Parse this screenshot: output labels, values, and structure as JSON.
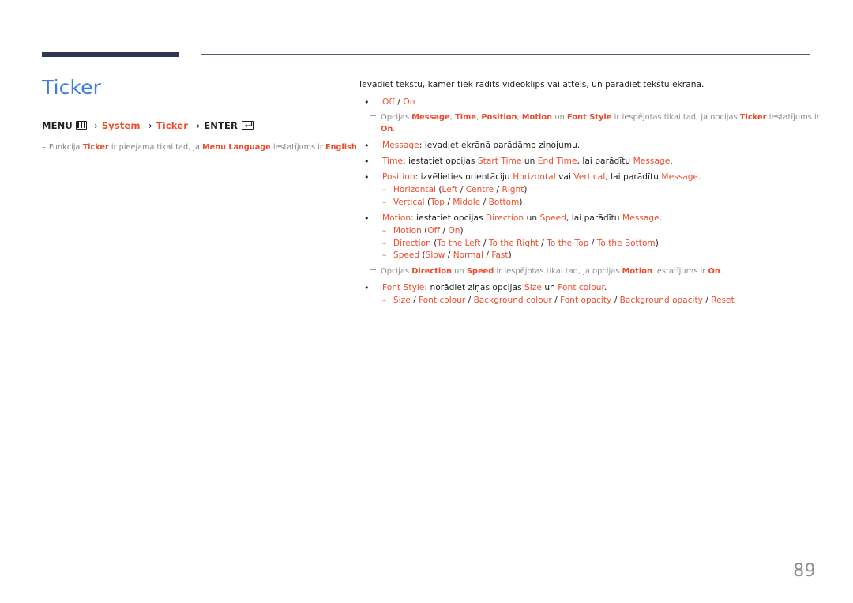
{
  "document": {
    "page_number": "89",
    "colors": {
      "title_blue": "#3c7ee0",
      "highlight_red": "#ee4b2b",
      "rule_navy": "#2e3655",
      "note_gray": "#8a8a8a"
    }
  },
  "left": {
    "title": "Ticker",
    "menu_path": {
      "menu_label": "MENU",
      "menu_icon": "menu-grid-icon",
      "arrow1": "→",
      "item1": "System",
      "arrow2": "→",
      "item2": "Ticker",
      "arrow3": "→",
      "enter_label": "ENTER",
      "enter_icon": "enter-key-icon"
    },
    "note": {
      "dash": "–",
      "text_before": "Funkcija",
      "hl1": "Ticker",
      "text_mid": "ir pieejama tikai tad, ja",
      "hl2": "Menu Language",
      "text_mid2": "iestatījums ir",
      "hl3": "English",
      "text_end": "."
    }
  },
  "right": {
    "intro": "Ievadiet tekstu, kamēr tiek rādīts videoklips vai attēls, un parādiet tekstu ekrānā.",
    "items": [
      {
        "name": "off-on",
        "parts": [
          {
            "t": "Off",
            "c": "red"
          },
          {
            "t": " / ",
            "c": "black"
          },
          {
            "t": "On",
            "c": "red"
          }
        ]
      },
      {
        "name": "note-ticker-on",
        "type": "note",
        "parts": [
          {
            "t": "Opcijas ",
            "c": "gray"
          },
          {
            "t": "Message",
            "c": "redbold"
          },
          {
            "t": ", ",
            "c": "gray"
          },
          {
            "t": "Time",
            "c": "redbold"
          },
          {
            "t": ", ",
            "c": "gray"
          },
          {
            "t": "Position",
            "c": "redbold"
          },
          {
            "t": ", ",
            "c": "gray"
          },
          {
            "t": "Motion",
            "c": "redbold"
          },
          {
            "t": " un ",
            "c": "gray"
          },
          {
            "t": "Font Style",
            "c": "redbold"
          },
          {
            "t": " ir iespējotas tikai tad, ja opcijas ",
            "c": "gray"
          },
          {
            "t": "Ticker",
            "c": "redbold"
          },
          {
            "t": " iestatījums ir ",
            "c": "gray"
          },
          {
            "t": "On",
            "c": "redbold"
          },
          {
            "t": ".",
            "c": "gray"
          }
        ]
      },
      {
        "name": "message",
        "parts": [
          {
            "t": "Message",
            "c": "red"
          },
          {
            "t": ": ievadiet ekrānā parādāmo ziņojumu.",
            "c": "black"
          }
        ]
      },
      {
        "name": "time",
        "parts": [
          {
            "t": "Time",
            "c": "red"
          },
          {
            "t": ": iestatiet opcijas ",
            "c": "black"
          },
          {
            "t": "Start Time",
            "c": "red"
          },
          {
            "t": " un ",
            "c": "black"
          },
          {
            "t": "End Time",
            "c": "red"
          },
          {
            "t": ", lai parādītu ",
            "c": "black"
          },
          {
            "t": "Message",
            "c": "red"
          },
          {
            "t": ".",
            "c": "black"
          }
        ]
      },
      {
        "name": "position",
        "parts": [
          {
            "t": "Position",
            "c": "red"
          },
          {
            "t": ": izvēlieties orientāciju ",
            "c": "black"
          },
          {
            "t": "Horizontal",
            "c": "red"
          },
          {
            "t": " vai ",
            "c": "black"
          },
          {
            "t": "Vertical",
            "c": "red"
          },
          {
            "t": ", lai parādītu ",
            "c": "black"
          },
          {
            "t": "Message",
            "c": "red"
          },
          {
            "t": ".",
            "c": "black"
          }
        ],
        "subs": [
          {
            "name": "position-horizontal",
            "parts": [
              {
                "t": "Horizontal ",
                "c": "red"
              },
              {
                "t": "(",
                "c": "black"
              },
              {
                "t": "Left",
                "c": "red"
              },
              {
                "t": " / ",
                "c": "black"
              },
              {
                "t": "Centre",
                "c": "red"
              },
              {
                "t": " / ",
                "c": "black"
              },
              {
                "t": "Right",
                "c": "red"
              },
              {
                "t": ")",
                "c": "black"
              }
            ]
          },
          {
            "name": "position-vertical",
            "parts": [
              {
                "t": "Vertical ",
                "c": "red"
              },
              {
                "t": "(",
                "c": "black"
              },
              {
                "t": "Top",
                "c": "red"
              },
              {
                "t": " / ",
                "c": "black"
              },
              {
                "t": "Middle",
                "c": "red"
              },
              {
                "t": " / ",
                "c": "black"
              },
              {
                "t": "Bottom",
                "c": "red"
              },
              {
                "t": ")",
                "c": "black"
              }
            ]
          }
        ]
      },
      {
        "name": "motion",
        "parts": [
          {
            "t": "Motion",
            "c": "red"
          },
          {
            "t": ": iestatiet opcijas ",
            "c": "black"
          },
          {
            "t": "Direction",
            "c": "red"
          },
          {
            "t": " un ",
            "c": "black"
          },
          {
            "t": "Speed",
            "c": "red"
          },
          {
            "t": ", lai parādītu ",
            "c": "black"
          },
          {
            "t": "Message",
            "c": "red"
          },
          {
            "t": ".",
            "c": "black"
          }
        ],
        "subs": [
          {
            "name": "motion-onoff",
            "parts": [
              {
                "t": "Motion ",
                "c": "red"
              },
              {
                "t": "(",
                "c": "black"
              },
              {
                "t": "Off",
                "c": "red"
              },
              {
                "t": " / ",
                "c": "black"
              },
              {
                "t": "On",
                "c": "red"
              },
              {
                "t": ")",
                "c": "black"
              }
            ]
          },
          {
            "name": "motion-direction",
            "parts": [
              {
                "t": "Direction ",
                "c": "red"
              },
              {
                "t": "(",
                "c": "black"
              },
              {
                "t": "To the Left",
                "c": "red"
              },
              {
                "t": " / ",
                "c": "black"
              },
              {
                "t": "To the Right",
                "c": "red"
              },
              {
                "t": " / ",
                "c": "black"
              },
              {
                "t": "To the Top",
                "c": "red"
              },
              {
                "t": " / ",
                "c": "black"
              },
              {
                "t": "To the Bottom",
                "c": "red"
              },
              {
                "t": ")",
                "c": "black"
              }
            ]
          },
          {
            "name": "motion-speed",
            "parts": [
              {
                "t": "Speed ",
                "c": "red"
              },
              {
                "t": "(",
                "c": "black"
              },
              {
                "t": "Slow",
                "c": "red"
              },
              {
                "t": " / ",
                "c": "black"
              },
              {
                "t": "Normal",
                "c": "red"
              },
              {
                "t": " / ",
                "c": "black"
              },
              {
                "t": "Fast",
                "c": "red"
              },
              {
                "t": ")",
                "c": "black"
              }
            ]
          }
        ]
      },
      {
        "name": "note-motion-on",
        "type": "note",
        "parts": [
          {
            "t": "Opcijas ",
            "c": "gray"
          },
          {
            "t": "Direction",
            "c": "redbold"
          },
          {
            "t": " un ",
            "c": "gray"
          },
          {
            "t": "Speed",
            "c": "redbold"
          },
          {
            "t": " ir iespējotas tikai tad, ja opcijas ",
            "c": "gray"
          },
          {
            "t": "Motion",
            "c": "redbold"
          },
          {
            "t": " iestatījums ir ",
            "c": "gray"
          },
          {
            "t": "On",
            "c": "redbold"
          },
          {
            "t": ".",
            "c": "gray"
          }
        ]
      },
      {
        "name": "font-style",
        "parts": [
          {
            "t": "Font Style",
            "c": "red"
          },
          {
            "t": ": norādiet ziņas opcijas ",
            "c": "black"
          },
          {
            "t": "Size",
            "c": "red"
          },
          {
            "t": " un ",
            "c": "black"
          },
          {
            "t": "Font colour",
            "c": "red"
          },
          {
            "t": ".",
            "c": "black"
          }
        ],
        "subs": [
          {
            "name": "font-style-options",
            "parts": [
              {
                "t": "Size",
                "c": "red"
              },
              {
                "t": " / ",
                "c": "black"
              },
              {
                "t": "Font colour",
                "c": "red"
              },
              {
                "t": " / ",
                "c": "black"
              },
              {
                "t": "Background colour",
                "c": "red"
              },
              {
                "t": " / ",
                "c": "black"
              },
              {
                "t": "Font opacity",
                "c": "red"
              },
              {
                "t": " / ",
                "c": "black"
              },
              {
                "t": "Background opacity",
                "c": "red"
              },
              {
                "t": " / ",
                "c": "black"
              },
              {
                "t": "Reset",
                "c": "red"
              }
            ]
          }
        ]
      }
    ]
  }
}
